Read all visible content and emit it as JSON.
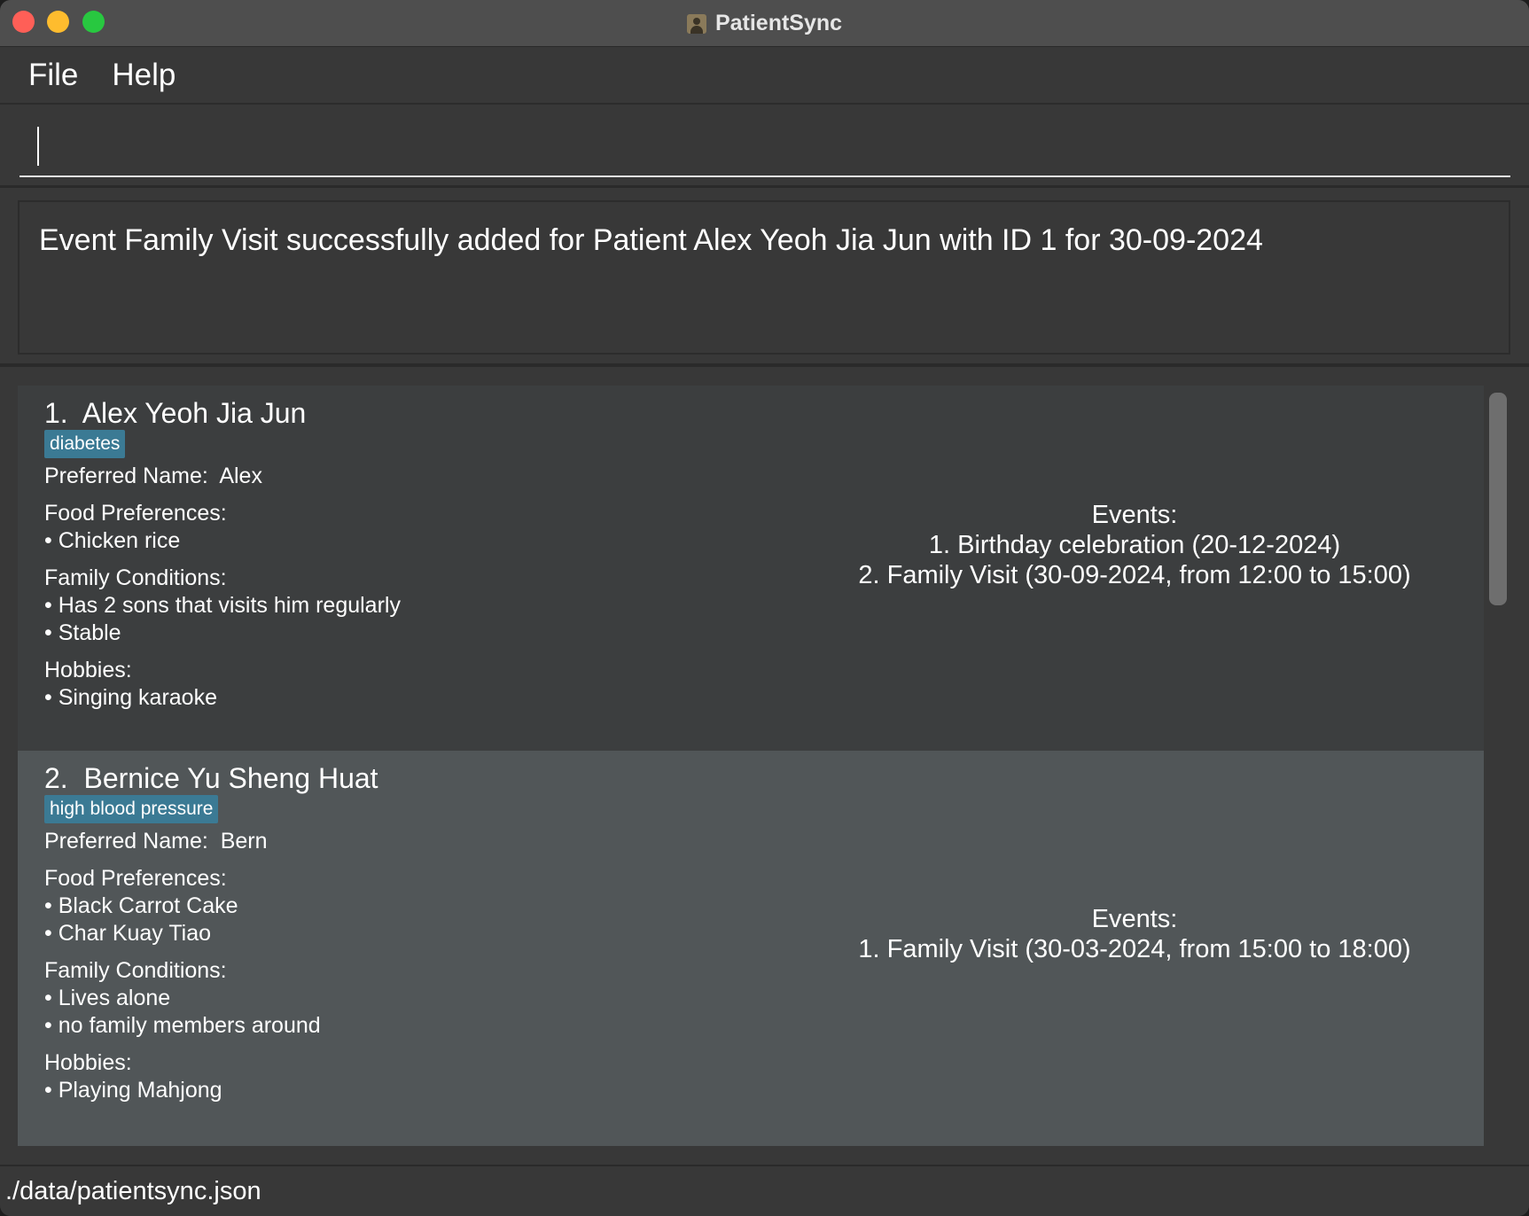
{
  "window": {
    "title": "PatientSync"
  },
  "menu": {
    "file": "File",
    "help": "Help"
  },
  "command": {
    "value": ""
  },
  "result": {
    "message": "Event Family Visit successfully added for Patient Alex Yeoh Jia Jun with ID 1 for 30-09-2024"
  },
  "patients": [
    {
      "index": "1.",
      "name": "Alex Yeoh Jia Jun",
      "tag": "diabetes",
      "preferred_name_label": "Preferred Name:",
      "preferred_name": "Alex",
      "food_label": "Food Preferences:",
      "food": [
        "Chicken rice"
      ],
      "family_label": "Family Conditions:",
      "family": [
        "Has 2 sons that visits him regularly",
        "Stable"
      ],
      "hobbies_label": "Hobbies:",
      "hobbies": [
        "Singing karaoke"
      ],
      "events_label": "Events:",
      "events": [
        "1. Birthday celebration (20-12-2024)",
        "2. Family Visit (30-09-2024, from 12:00 to 15:00)"
      ]
    },
    {
      "index": "2.",
      "name": "Bernice Yu Sheng Huat",
      "tag": "high blood pressure",
      "preferred_name_label": "Preferred Name:",
      "preferred_name": "Bern",
      "food_label": "Food Preferences:",
      "food": [
        "Black Carrot Cake",
        "Char Kuay Tiao"
      ],
      "family_label": "Family Conditions:",
      "family": [
        "Lives alone",
        "no family members around"
      ],
      "hobbies_label": "Hobbies:",
      "hobbies": [
        "Playing Mahjong"
      ],
      "events_label": "Events:",
      "events": [
        "1. Family Visit (30-03-2024, from 15:00 to 18:00)"
      ]
    }
  ],
  "status": {
    "file_path": "./data/patientsync.json"
  }
}
